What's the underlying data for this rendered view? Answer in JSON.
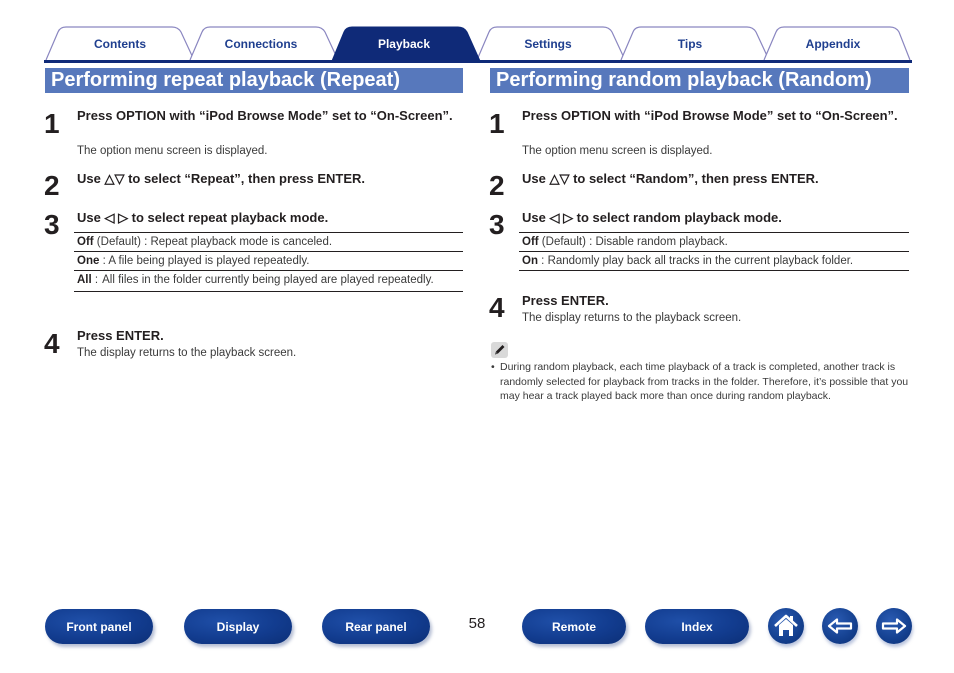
{
  "tabs": [
    {
      "label": "Contents",
      "active": false
    },
    {
      "label": "Connections",
      "active": false
    },
    {
      "label": "Playback",
      "active": true
    },
    {
      "label": "Settings",
      "active": false
    },
    {
      "label": "Tips",
      "active": false
    },
    {
      "label": "Appendix",
      "active": false
    }
  ],
  "colors": {
    "brand_dark": "#0f2a78",
    "heading_bg": "#5778bc",
    "tab_text": "#1f3f8f",
    "tab_outline": "#8a86c0"
  },
  "repeat": {
    "title": "Performing repeat playback (Repeat)",
    "steps": [
      {
        "num": "1",
        "title": "Press OPTION with “iPod Browse Mode” set to “On-Screen”.",
        "desc": "The option menu screen is displayed."
      },
      {
        "num": "2",
        "title": "Use △▽ to select “Repeat”, then press ENTER."
      },
      {
        "num": "3",
        "title": "Use ◁ ▷ to select repeat playback mode."
      },
      {
        "num": "4",
        "title": "Press ENTER.",
        "desc": "The display returns to the playback screen."
      }
    ],
    "options": [
      {
        "key": "Off",
        "text": " (Default) : Repeat playback mode is canceled."
      },
      {
        "key": "One",
        "text": " : A file being played is played repeatedly."
      },
      {
        "key": "All",
        "sep": " :",
        "text": "All files in the folder currently being played are played repeatedly."
      }
    ]
  },
  "random": {
    "title": "Performing random playback (Random)",
    "steps": [
      {
        "num": "1",
        "title": "Press OPTION with “iPod Browse Mode” set to “On-Screen”.",
        "desc": "The option menu screen is displayed."
      },
      {
        "num": "2",
        "title": "Use △▽ to select “Random”, then press ENTER."
      },
      {
        "num": "3",
        "title": "Use ◁ ▷ to select random playback mode."
      },
      {
        "num": "4",
        "title": "Press ENTER.",
        "desc": "The display returns to the playback screen."
      }
    ],
    "options": [
      {
        "key": "Off",
        "text": " (Default) : Disable random playback."
      },
      {
        "key": "On",
        "text": " : Randomly play back all tracks in the current playback folder."
      }
    ],
    "note": {
      "icon": "pencil-icon",
      "bullet": "•",
      "text": "During random playback, each time playback of a track is completed, another track is randomly selected for playback from tracks in the folder. Therefore, it’s possible that you may hear a track played back more than once during random playback."
    }
  },
  "footer": {
    "buttons": [
      "Front panel",
      "Display",
      "Rear panel",
      "Remote",
      "Index"
    ],
    "page_number": "58",
    "icons": [
      "home-icon",
      "back-arrow-icon",
      "forward-arrow-icon"
    ]
  }
}
